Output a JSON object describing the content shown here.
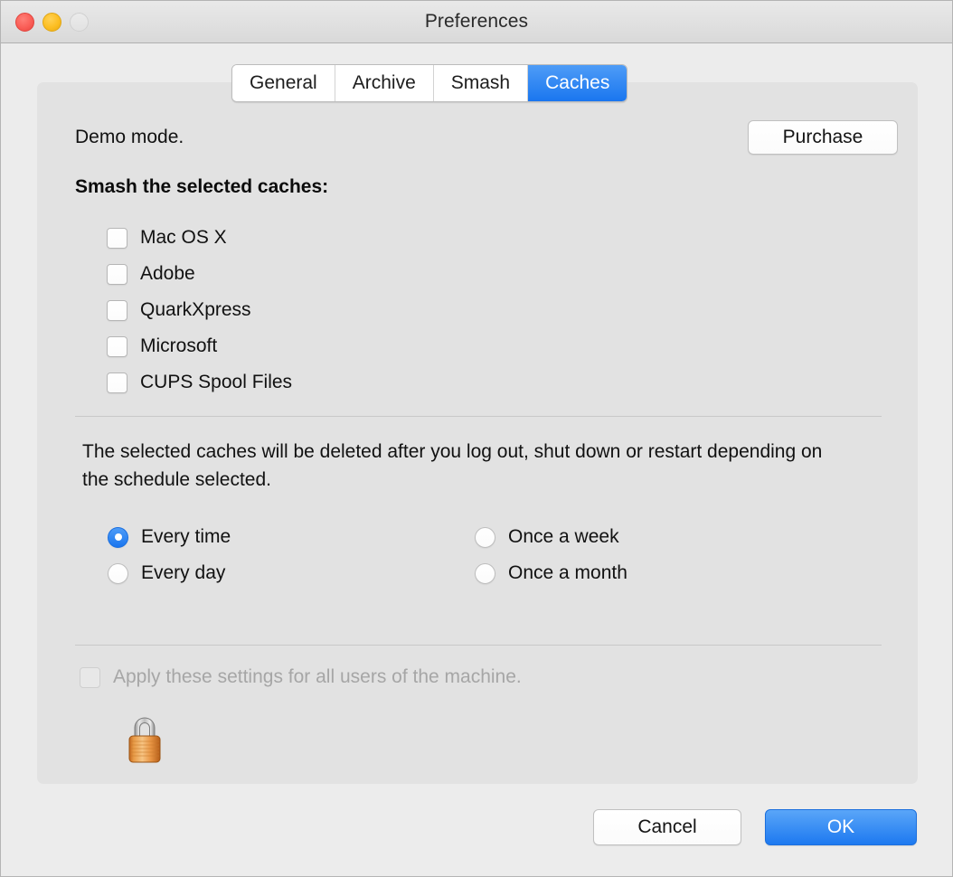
{
  "window": {
    "title": "Preferences",
    "traffic_lights": [
      {
        "name": "close",
        "color": "#fa5e57",
        "enabled": true
      },
      {
        "name": "minimize",
        "color": "#fcbe22",
        "enabled": true
      },
      {
        "name": "zoom",
        "color": "#e4e4e4",
        "enabled": false
      }
    ]
  },
  "tabs": [
    {
      "label": "General",
      "selected": false
    },
    {
      "label": "Archive",
      "selected": false
    },
    {
      "label": "Smash",
      "selected": false
    },
    {
      "label": "Caches",
      "selected": true
    }
  ],
  "panel": {
    "demo_label": "Demo mode.",
    "purchase_label": "Purchase",
    "section_title": "Smash the selected caches:",
    "caches": [
      {
        "label": "Mac OS X",
        "checked": false
      },
      {
        "label": "Adobe",
        "checked": false
      },
      {
        "label": "QuarkXpress",
        "checked": false
      },
      {
        "label": "Microsoft",
        "checked": false
      },
      {
        "label": "CUPS Spool Files",
        "checked": false
      }
    ],
    "description": "The selected caches will be deleted after you log out, shut down or restart depending on the schedule selected.",
    "schedule_options": [
      {
        "label": "Every time",
        "selected": true
      },
      {
        "label": "Once a week",
        "selected": false
      },
      {
        "label": "Every day",
        "selected": false
      },
      {
        "label": "Once a month",
        "selected": false
      }
    ],
    "apply_all": {
      "label": "Apply these settings for all users of the machine.",
      "checked": false,
      "disabled": true
    },
    "lock_icon": "padlock-locked-icon"
  },
  "footer": {
    "cancel_label": "Cancel",
    "ok_label": "OK"
  },
  "colors": {
    "accent_blue": "#1d79f0",
    "window_bg": "#ececec",
    "panel_bg": "#e2e2e2",
    "text": "#111111",
    "disabled_text": "#a6a6a6"
  }
}
